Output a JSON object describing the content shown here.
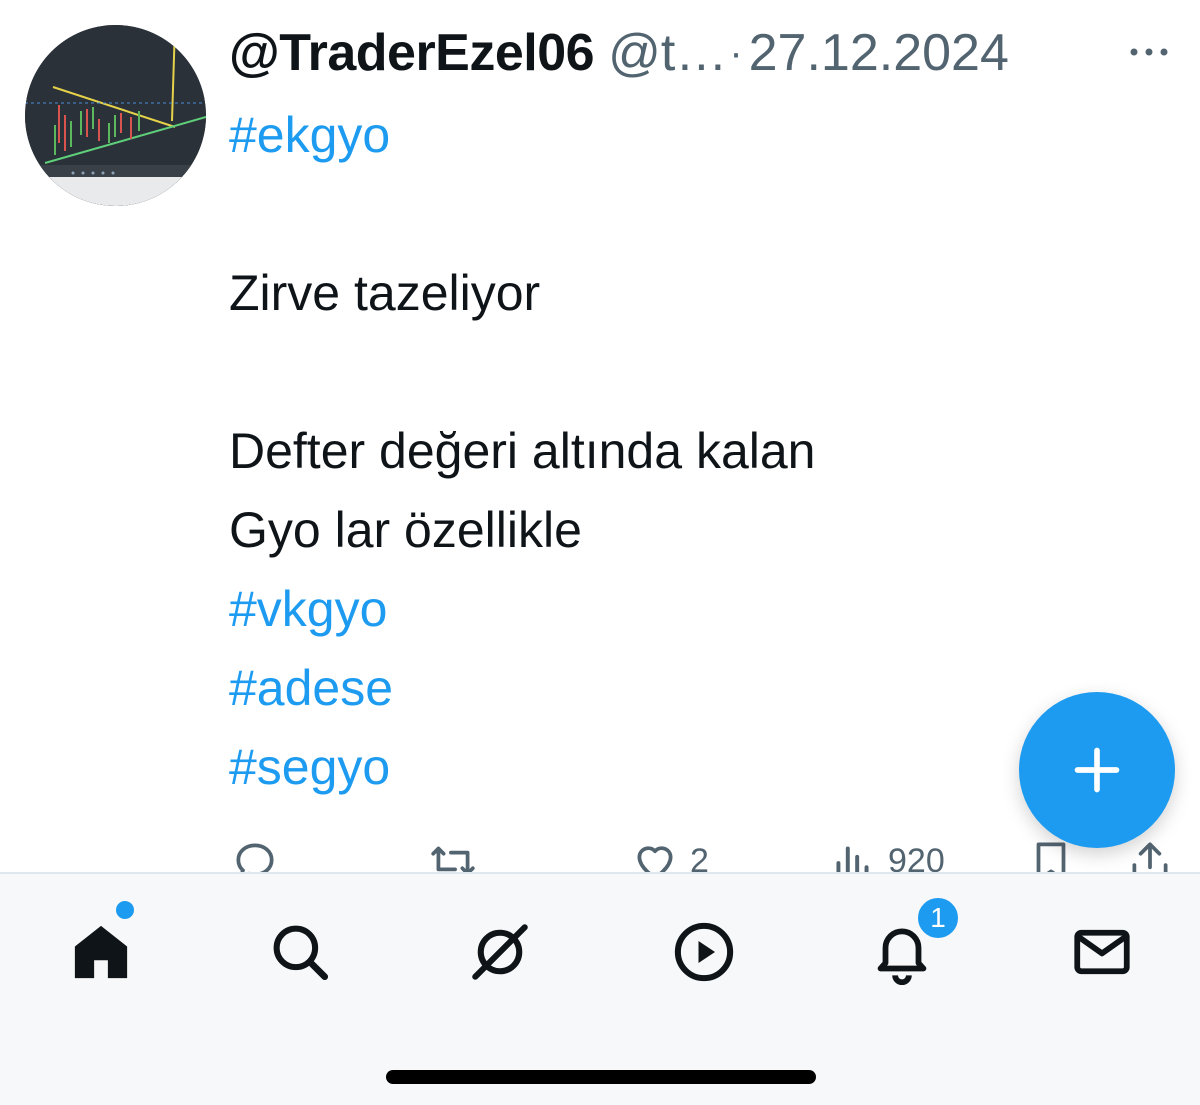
{
  "tweet": {
    "display_name": "@TraderEzel06",
    "handle": "@t…",
    "separator": "·",
    "date": "27.12.2024",
    "lines": [
      {
        "text": "#ekgyo",
        "hashtag": true
      },
      {
        "text": "",
        "hashtag": false
      },
      {
        "text": "Zirve tazeliyor",
        "hashtag": false
      },
      {
        "text": "",
        "hashtag": false
      },
      {
        "text": "Defter değeri altında kalan",
        "hashtag": false
      },
      {
        "text": "Gyo lar özellikle",
        "hashtag": false
      },
      {
        "text": "#vkgyo",
        "hashtag": true
      },
      {
        "text": "#adese",
        "hashtag": true
      },
      {
        "text": "#segyo",
        "hashtag": true
      }
    ],
    "actions": {
      "reply_icon": "reply-icon",
      "retweet_icon": "retweet-icon",
      "like_icon": "heart-icon",
      "like_count": "2",
      "views_icon": "views-icon",
      "views_count": "920",
      "bookmark_icon": "bookmark-icon",
      "share_icon": "share-icon"
    }
  },
  "fab": {
    "icon": "plus-icon"
  },
  "tabbar": {
    "items": [
      "home-icon",
      "search-icon",
      "grok-icon",
      "video-icon",
      "bell-icon",
      "mail-icon"
    ],
    "notification_badge": "1"
  },
  "colors": {
    "accent": "#1d9bf0",
    "text": "#0f1419",
    "secondary": "#536471"
  }
}
